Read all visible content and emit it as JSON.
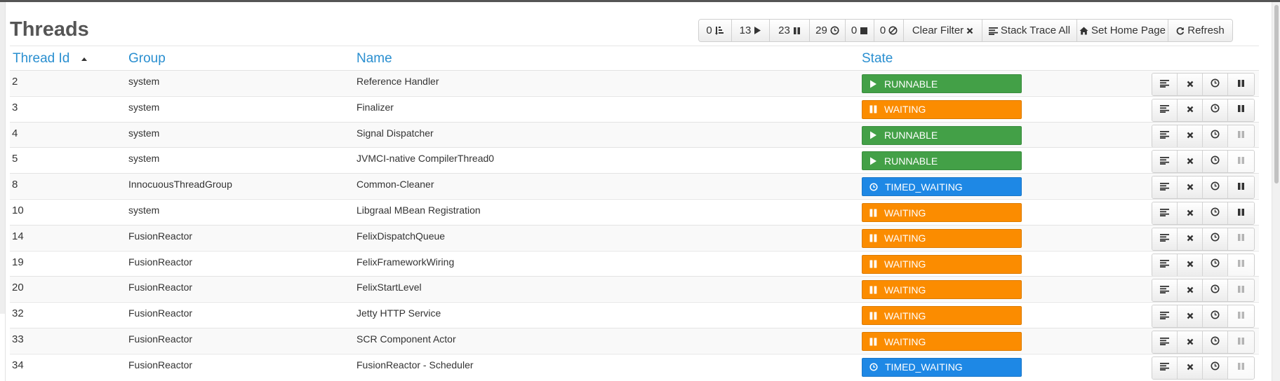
{
  "page": {
    "title": "Threads"
  },
  "toolbar": {
    "filters": [
      {
        "count": "0",
        "icon": "sort-amount-icon"
      },
      {
        "count": "13",
        "icon": "play-icon"
      },
      {
        "count": "23",
        "icon": "pause-icon"
      },
      {
        "count": "29",
        "icon": "clock-icon"
      },
      {
        "count": "0",
        "icon": "stop-icon"
      },
      {
        "count": "0",
        "icon": "ban-icon"
      }
    ],
    "clear_filter": "Clear Filter",
    "stack_trace_all": "Stack Trace All",
    "set_home_page": "Set Home Page",
    "refresh": "Refresh"
  },
  "table": {
    "columns": {
      "id": "Thread Id",
      "group": "Group",
      "name": "Name",
      "state": "State"
    },
    "rows": [
      {
        "id": "2",
        "group": "system",
        "name": "Reference Handler",
        "state": "RUNNABLE",
        "suspend_enabled": true
      },
      {
        "id": "3",
        "group": "system",
        "name": "Finalizer",
        "state": "WAITING",
        "suspend_enabled": true
      },
      {
        "id": "4",
        "group": "system",
        "name": "Signal Dispatcher",
        "state": "RUNNABLE",
        "suspend_enabled": false
      },
      {
        "id": "5",
        "group": "system",
        "name": "JVMCI-native CompilerThread0",
        "state": "RUNNABLE",
        "suspend_enabled": false
      },
      {
        "id": "8",
        "group": "InnocuousThreadGroup",
        "name": "Common-Cleaner",
        "state": "TIMED_WAITING",
        "suspend_enabled": true
      },
      {
        "id": "10",
        "group": "system",
        "name": "Libgraal MBean Registration",
        "state": "WAITING",
        "suspend_enabled": true
      },
      {
        "id": "14",
        "group": "FusionReactor",
        "name": "FelixDispatchQueue",
        "state": "WAITING",
        "suspend_enabled": false
      },
      {
        "id": "19",
        "group": "FusionReactor",
        "name": "FelixFrameworkWiring",
        "state": "WAITING",
        "suspend_enabled": false
      },
      {
        "id": "20",
        "group": "FusionReactor",
        "name": "FelixStartLevel",
        "state": "WAITING",
        "suspend_enabled": false
      },
      {
        "id": "32",
        "group": "FusionReactor",
        "name": "Jetty HTTP Service",
        "state": "WAITING",
        "suspend_enabled": false
      },
      {
        "id": "33",
        "group": "FusionReactor",
        "name": "SCR Component Actor",
        "state": "WAITING",
        "suspend_enabled": false
      },
      {
        "id": "34",
        "group": "FusionReactor",
        "name": "FusionReactor - Scheduler",
        "state": "TIMED_WAITING",
        "suspend_enabled": false
      }
    ]
  },
  "colors": {
    "RUNNABLE": "#43a047",
    "WAITING": "#fb8c00",
    "TIMED_WAITING": "#1e88e5",
    "link": "#2a8fd0"
  }
}
